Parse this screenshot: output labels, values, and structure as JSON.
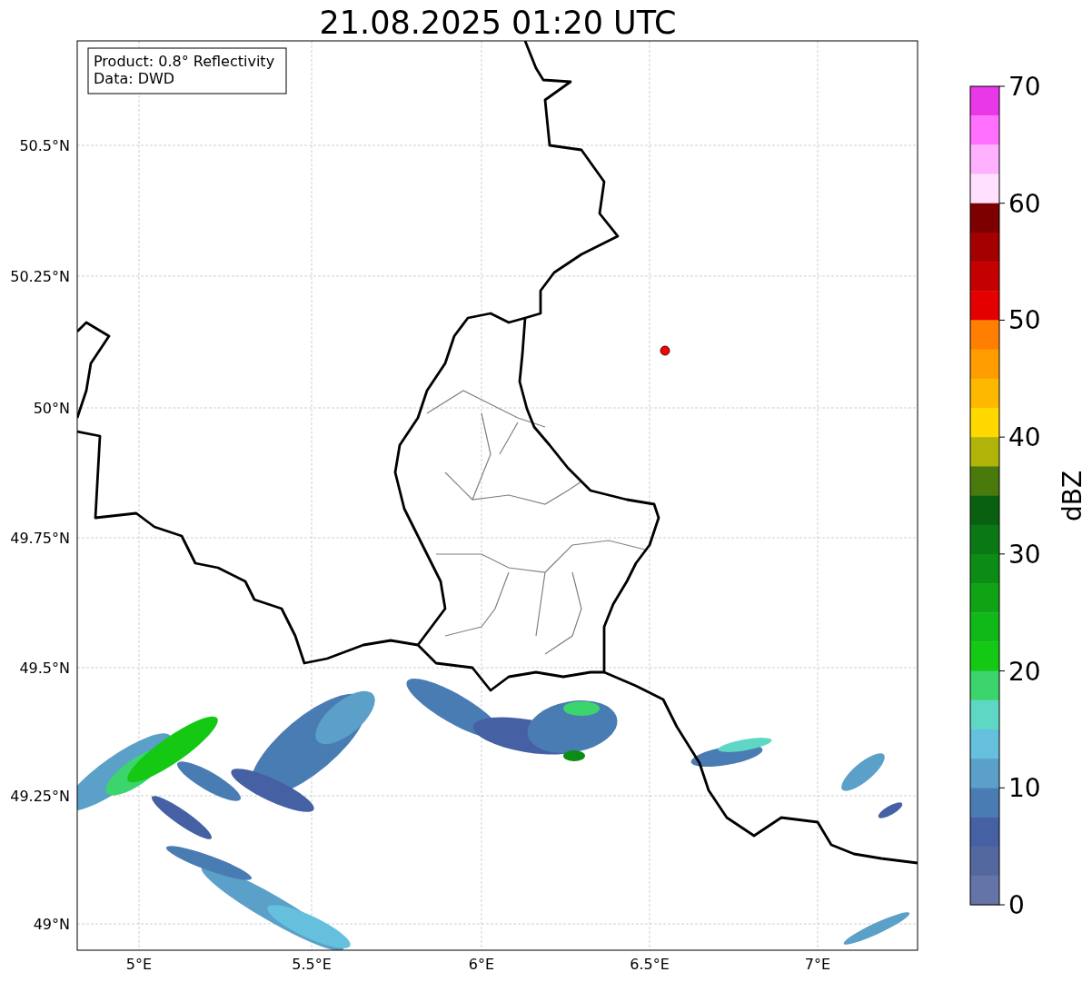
{
  "title": "21.08.2025 01:20 UTC",
  "map": {
    "info_box": [
      "Product: 0.8° Reflectivity",
      "Data: DWD"
    ],
    "lat_labels": [
      "50.5°N",
      "50.25°N",
      "50°N",
      "49.75°N",
      "49.5°N",
      "49.25°N",
      "49°N"
    ],
    "lon_labels": [
      "5°E",
      "5.5°E",
      "6°E",
      "6.5°E",
      "7°E"
    ]
  },
  "colorbar": {
    "label": "dBZ",
    "ticks": [
      "70",
      "60",
      "50",
      "40",
      "30",
      "20",
      "10",
      "0"
    ],
    "bins": [
      {
        "color": "#e838e8"
      },
      {
        "color": "#ff70ff"
      },
      {
        "color": "#ffb0ff"
      },
      {
        "color": "#ffe0ff"
      },
      {
        "color": "#7c0000"
      },
      {
        "color": "#a40000"
      },
      {
        "color": "#c40000"
      },
      {
        "color": "#e40000"
      },
      {
        "color": "#ff8000"
      },
      {
        "color": "#ff9c00"
      },
      {
        "color": "#ffb800"
      },
      {
        "color": "#ffd800"
      },
      {
        "color": "#b0b408"
      },
      {
        "color": "#4a7a0c"
      },
      {
        "color": "#086010"
      },
      {
        "color": "#0a7814"
      },
      {
        "color": "#0c8c14"
      },
      {
        "color": "#10a414"
      },
      {
        "color": "#10b818"
      },
      {
        "color": "#14c814"
      },
      {
        "color": "#3cd46c"
      },
      {
        "color": "#5ed8c4"
      },
      {
        "color": "#64c0dc"
      },
      {
        "color": "#5aa0c8"
      },
      {
        "color": "#4a7cb4"
      },
      {
        "color": "#4660a4"
      },
      {
        "color": "#5468a0"
      },
      {
        "color": "#6474a8"
      }
    ]
  }
}
